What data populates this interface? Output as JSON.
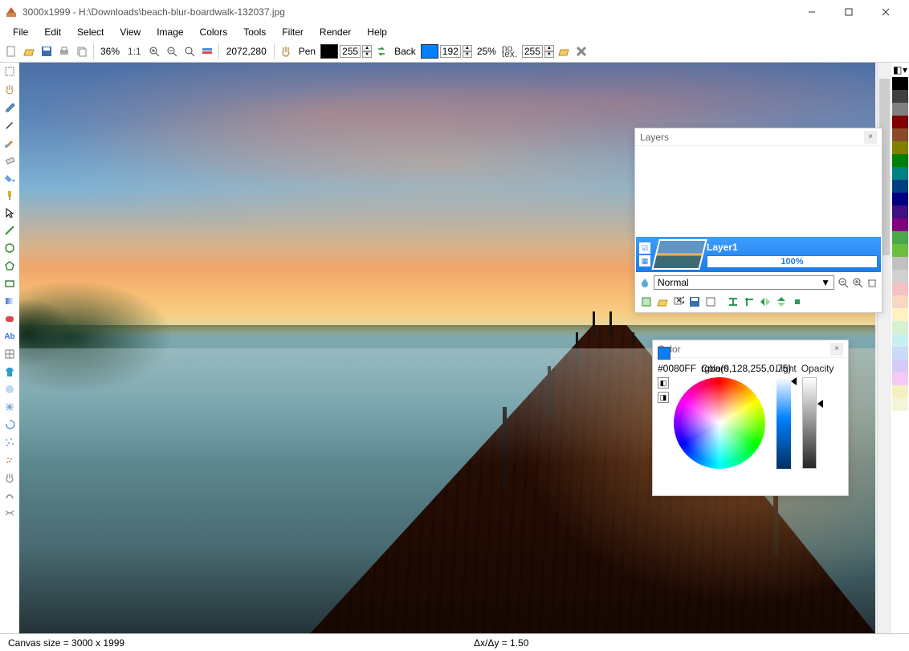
{
  "title": "3000x1999 - H:\\Downloads\\beach-blur-boardwalk-132037.jpg",
  "menus": [
    "File",
    "Edit",
    "Select",
    "View",
    "Image",
    "Colors",
    "Tools",
    "Filter",
    "Render",
    "Help"
  ],
  "toolbar": {
    "zoom_pct": "36%",
    "one_to_one": "1:1",
    "coords": "2072,280",
    "tool_name": "Pen",
    "pen_color": "#000000",
    "pen_val": "255",
    "back_label": "Back",
    "back_color": "#0080FF",
    "back_val": "192",
    "opacity_pct": "25%",
    "notex_label": "no tex.",
    "notex_val": "255"
  },
  "left_tools": [
    "selection-icon",
    "hand-icon",
    "eyedropper-icon",
    "pencil-icon",
    "brush-icon",
    "eraser-icon",
    "bucket-icon",
    "pin-icon",
    "pointer-icon",
    "line-icon",
    "circle-icon",
    "polygon-icon",
    "rect-icon",
    "gradient-icon",
    "roundrect-icon",
    "text-icon",
    "grid-icon",
    "tshirt-icon",
    "blur-icon",
    "burst-icon",
    "swirl-icon",
    "noise-icon",
    "spray-icon",
    "glove-icon",
    "deform-icon",
    "warp-icon"
  ],
  "palette": [
    "#000000",
    "#404040",
    "#808080",
    "#800000",
    "#8b4a2b",
    "#808000",
    "#008000",
    "#008080",
    "#004080",
    "#000080",
    "#401080",
    "#800080",
    "#4aa84a",
    "#6abf40",
    "#c0c0c0",
    "#d0d0d0",
    "#f4c2c2",
    "#f8d8c0",
    "#fff2c0",
    "#d8f0d0",
    "#c8f0f0",
    "#cadbf7",
    "#d8caf7",
    "#f5caf7",
    "#f5f0c0",
    "#f5f5dc",
    "#ffffff"
  ],
  "layers_panel": {
    "title": "Layers",
    "layer_name": "Layer1",
    "layer_opacity": "100%",
    "blend_mode": "Normal"
  },
  "color_panel": {
    "title": "Color",
    "labels": {
      "colors": "Colors",
      "light": "Light",
      "opacity": "Opacity"
    },
    "current_hex": "#0080FF",
    "current_rgba": "rgba(0,128,255,0.75)"
  },
  "status": {
    "canvas": "Canvas size = 3000 x 1999",
    "ratio": "Δx/Δy = 1.50"
  }
}
